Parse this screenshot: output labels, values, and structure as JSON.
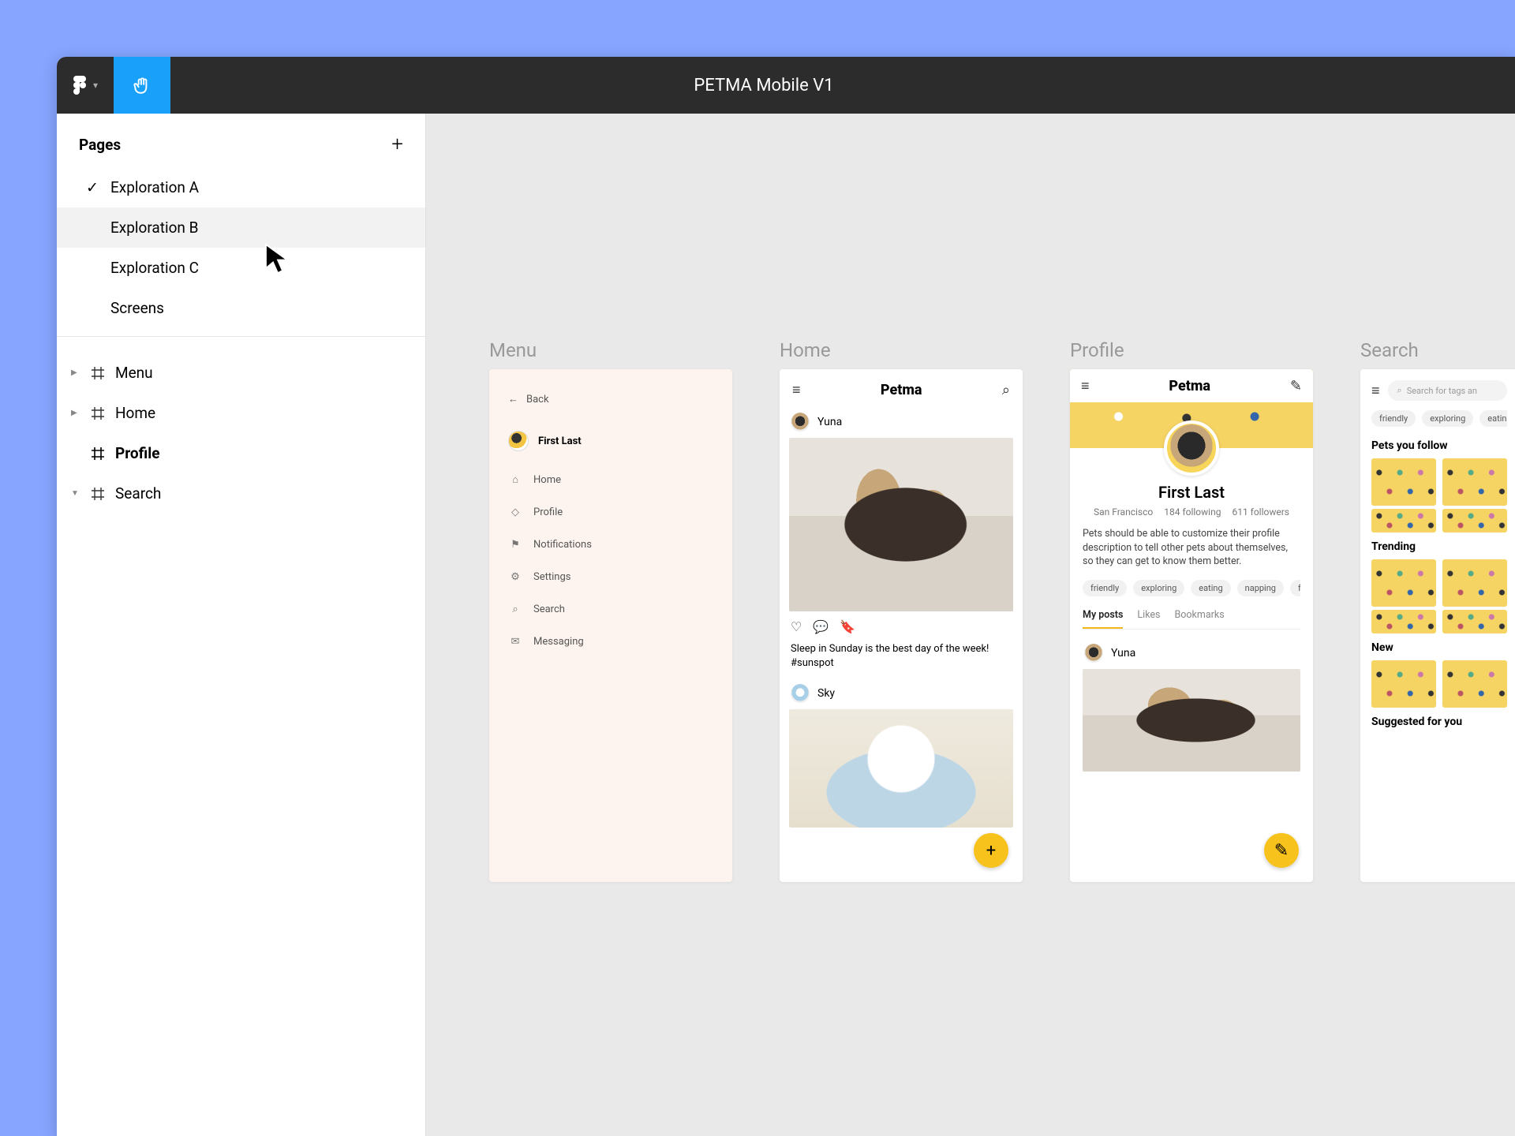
{
  "title": "PETMA Mobile V1",
  "sidebar": {
    "pages_label": "Pages",
    "pages": [
      {
        "label": "Exploration A",
        "checked": true
      },
      {
        "label": "Exploration B",
        "checked": false,
        "hover": true
      },
      {
        "label": "Exploration C",
        "checked": false
      },
      {
        "label": "Screens",
        "checked": false
      }
    ],
    "layers": [
      {
        "label": "Menu",
        "bold": false,
        "caret": "right"
      },
      {
        "label": "Home",
        "bold": false,
        "caret": "right"
      },
      {
        "label": "Profile",
        "bold": true,
        "caret": "none"
      },
      {
        "label": "Search",
        "bold": false,
        "caret": "down"
      }
    ]
  },
  "artboards": {
    "menu": {
      "title": "Menu",
      "back": "Back",
      "user": "First Last",
      "items": [
        "Home",
        "Profile",
        "Notifications",
        "Settings",
        "Search",
        "Messaging"
      ],
      "icons": [
        "⌂",
        "◇",
        "⚑",
        "⚙",
        "○",
        "💬"
      ]
    },
    "home": {
      "title": "Home",
      "brand": "Petma",
      "post1_user": "Yuna",
      "post1_caption": "Sleep in Sunday is the best day of the week! #sunspot",
      "post2_user": "Sky"
    },
    "profile": {
      "title": "Profile",
      "brand": "Petma",
      "name": "First Last",
      "location": "San Francisco",
      "following": "184 following",
      "followers": "611 followers",
      "bio": "Pets should be able to customize their profile description to tell other pets about themselves, so they can get to know them better.",
      "tags": [
        "friendly",
        "exploring",
        "eating",
        "napping",
        "fetch"
      ],
      "tabs": [
        "My posts",
        "Likes",
        "Bookmarks"
      ],
      "feed_user": "Yuna"
    },
    "search": {
      "title": "Search",
      "placeholder": "Search for tags an",
      "top_tags": [
        "friendly",
        "exploring",
        "eating"
      ],
      "sections": [
        "Pets you follow",
        "Trending",
        "New",
        "Suggested for you"
      ]
    }
  }
}
